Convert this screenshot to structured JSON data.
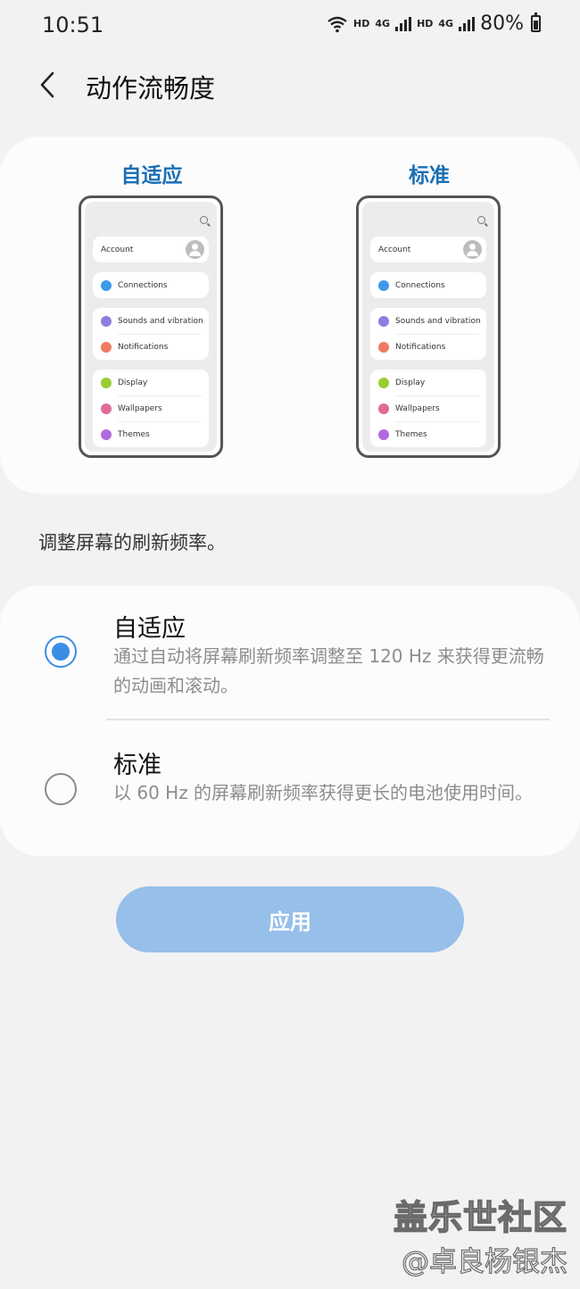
{
  "status_bar": {
    "time": "10:51",
    "hd1": "HD",
    "net1": "4G",
    "hd2": "HD",
    "net2": "4G",
    "battery": "80%"
  },
  "header": {
    "title": "动作流畅度",
    "back_icon": "chevron-left-icon"
  },
  "preview": {
    "adaptive_label": "自适应",
    "standard_label": "标准",
    "mock_items": {
      "account": "Account",
      "connections": "Connections",
      "sounds": "Sounds and vibration",
      "notifications": "Notifications",
      "display": "Display",
      "wallpapers": "Wallpapers",
      "themes": "Themes"
    },
    "icon_colors": {
      "connections": "#3d9be9",
      "sounds": "#8a7fe0",
      "notifications": "#ef7a62",
      "display": "#9acd32",
      "wallpapers": "#e06b9a",
      "themes": "#b26adf"
    }
  },
  "description": "调整屏幕的刷新频率。",
  "options": [
    {
      "title": "自适应",
      "description": "通过自动将屏幕刷新频率调整至 120 Hz 来获得更流畅的动画和滚动。",
      "selected": true
    },
    {
      "title": "标准",
      "description": "以 60 Hz 的屏幕刷新频率获得更长的电池使用时间。",
      "selected": false
    }
  ],
  "apply_button": "应用",
  "accent_color": "#3a8ee6",
  "watermark": {
    "line1": "盖乐世社区",
    "line2": "@卓良杨银杰"
  }
}
